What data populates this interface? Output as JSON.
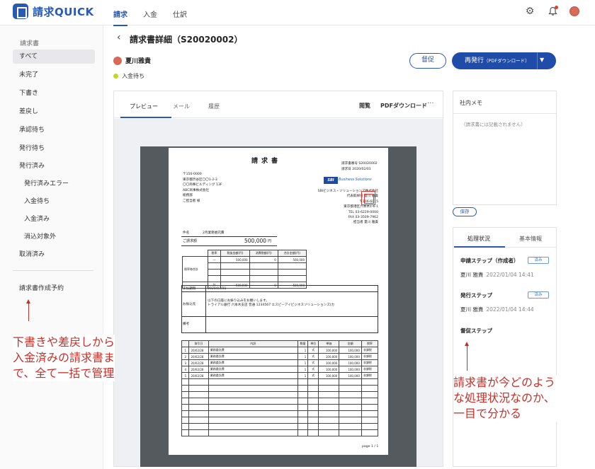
{
  "header": {
    "logo_text": "請求QUICK",
    "nav": [
      "請求",
      "入金",
      "仕訳"
    ],
    "icons": [
      "gear-icon",
      "bell-icon",
      "avatar"
    ]
  },
  "sidebar": {
    "title": "請求書",
    "items": [
      {
        "label": "すべて",
        "selected": true
      },
      {
        "label": "未完了"
      },
      {
        "label": "下書き"
      },
      {
        "label": "差戻し"
      },
      {
        "label": "承認待ち"
      },
      {
        "label": "発行待ち"
      },
      {
        "label": "発行済み"
      },
      {
        "label": "発行済みエラー",
        "sub": true
      },
      {
        "label": "入金待ち",
        "sub": true
      },
      {
        "label": "入金済み",
        "sub": true
      },
      {
        "label": "消込対象外",
        "sub": true
      },
      {
        "label": "取消済み"
      }
    ],
    "schedule": "請求書作成予約"
  },
  "main": {
    "title": "請求書詳細（S20020002）",
    "customer": "夏川雅貴",
    "status": "入金待ち",
    "remind_button": "督促",
    "reissue_button": "再発行",
    "reissue_sub": "（PDFダウンロード）",
    "tabs": [
      "プレビュー",
      "メール",
      "履歴"
    ],
    "tools": [
      "閲覧",
      "PDFダウンロード"
    ],
    "more": "···"
  },
  "invoice": {
    "title": "請求書",
    "number": "請求書番号 S20020002",
    "date": "請求日 2020/02/01",
    "client": [
      "〒150-0000",
      "東京都渋谷区〇〇1-2-3",
      "〇〇商事ビルディング 13F",
      "ABC商事株式会社",
      "総務部",
      "ご担当者 様"
    ],
    "brand_badge": "SBI",
    "brand_sub": "Business Solutions",
    "issuer": [
      "SBIビジネス・ソリューションズ株式会社",
      "代表取締役 夏川 雅貴",
      "〒106-6015",
      "東京都港区六本木1-6-1",
      "TEL 03-6229-0000",
      "FAX 03-3509-7962",
      "担当者 夏川 雅貴"
    ],
    "subject_label": "件名",
    "subject": "2月業務委託費",
    "amount_label": "ご請求額",
    "amount": "500,000",
    "amount_unit": "円",
    "tax_headers": [
      "税率",
      "税抜金額(円)",
      "消費税額(円)",
      "合計金額(円)"
    ],
    "tax_row_label": "税率毎合計",
    "tax_rows": [
      [
        "―",
        "500,000",
        "0",
        "500,000"
      ]
    ],
    "total_label": "計",
    "total_row": [
      "500,000",
      "0",
      "500,000"
    ],
    "due_label": "支払期限",
    "due": "2020/03/31",
    "bank_label": "お振込先",
    "bank_text": [
      "以下の口座にお振り込みをお願いします。",
      "トライアル銀行 六本木支店 普通 1234567 エスビーアイビジネスソリューションズ(カ"
    ],
    "remark_label": "備考",
    "item_headers": [
      "",
      "取引日",
      "内訳",
      "数量",
      "単位",
      "単価",
      "金額",
      "税率"
    ],
    "items": [
      [
        "1",
        "20/02/28",
        "業務委託費",
        "1",
        "式",
        "100,000",
        "100,000",
        "非課税"
      ],
      [
        "2",
        "20/02/28",
        "業務委託費",
        "1",
        "式",
        "100,000",
        "100,000",
        "非課税"
      ],
      [
        "3",
        "20/02/28",
        "業務委託費",
        "1",
        "式",
        "100,000",
        "100,000",
        "非課税"
      ],
      [
        "4",
        "20/02/28",
        "業務委託費",
        "1",
        "式",
        "100,000",
        "100,000",
        "非課税"
      ],
      [
        "5",
        "20/02/28",
        "業務委託費",
        "1",
        "式",
        "100,000",
        "100,000",
        "非課税"
      ]
    ],
    "page": "page 1 / 1"
  },
  "memo": {
    "title": "社内メモ",
    "placeholder": "（請求書には記載されません）",
    "save": "保存"
  },
  "process": {
    "tabs": [
      "処理状況",
      "基本情報"
    ],
    "steps": [
      {
        "title": "申請ステップ（作成者）",
        "badge": "済み",
        "person": "夏川 雅貴",
        "date": "2022/01/04 14:41"
      },
      {
        "title": "発行ステップ",
        "badge": "済み",
        "person": "夏川 雅貴",
        "date": "2022/01/04 14:44"
      },
      {
        "title": "督促ステップ"
      }
    ]
  },
  "annotations": {
    "left": [
      "下書きや差戻しから",
      "入金済みの請求書ま",
      "で、全て一括で管理"
    ],
    "right": [
      "請求書が今どのよう",
      "な処理状況なのか、",
      "一目で分かる"
    ]
  },
  "colors": {
    "brand": "#2a5ab0",
    "annotation": "#c8302a",
    "status_dot": "#c4d42a"
  }
}
